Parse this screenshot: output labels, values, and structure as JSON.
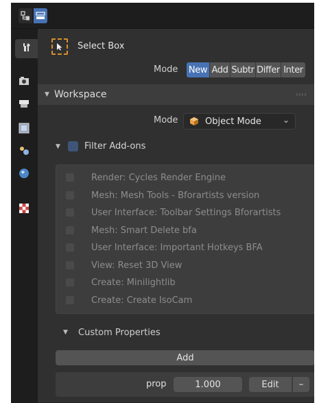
{
  "header": {
    "editor_type_icon": "properties-editor-icon",
    "display_mode_icon": "outliner-toggle-icon"
  },
  "tabs": [
    {
      "icon": "tool-icon",
      "active": true
    },
    {
      "icon": "render-icon"
    },
    {
      "icon": "output-icon"
    },
    {
      "icon": "view-layer-icon"
    },
    {
      "icon": "scene-icon"
    },
    {
      "icon": "world-icon"
    },
    {
      "icon": "texture-icon"
    }
  ],
  "tool": {
    "label": "Select Box",
    "mode_label": "Mode",
    "modes": [
      "New",
      "Add",
      "Subtr",
      "Differ",
      "Inter"
    ],
    "selected_mode": "New"
  },
  "workspace": {
    "title": "Workspace",
    "mode_label": "Mode",
    "mode_value": "Object Mode",
    "filter_label": "Filter Add-ons",
    "addons": [
      "Render: Cycles Render Engine",
      "Mesh: Mesh Tools - Bforartists version",
      "User Interface: Toolbar Settings Bforartists",
      "Mesh: Smart Delete bfa",
      "User Interface: Important Hotkeys BFA",
      "View: Reset 3D View",
      "Create: Minilightlib",
      "Create: Create IsoCam"
    ]
  },
  "custom_properties": {
    "title": "Custom Properties",
    "add_label": "Add",
    "prop_name": "prop",
    "prop_value": "1.000",
    "edit_label": "Edit",
    "remove_label": "–"
  },
  "colors": {
    "accent": "#4772b3",
    "panel": "#303030",
    "header": "#1d1d1d",
    "tool_outline": "#d8902d"
  }
}
